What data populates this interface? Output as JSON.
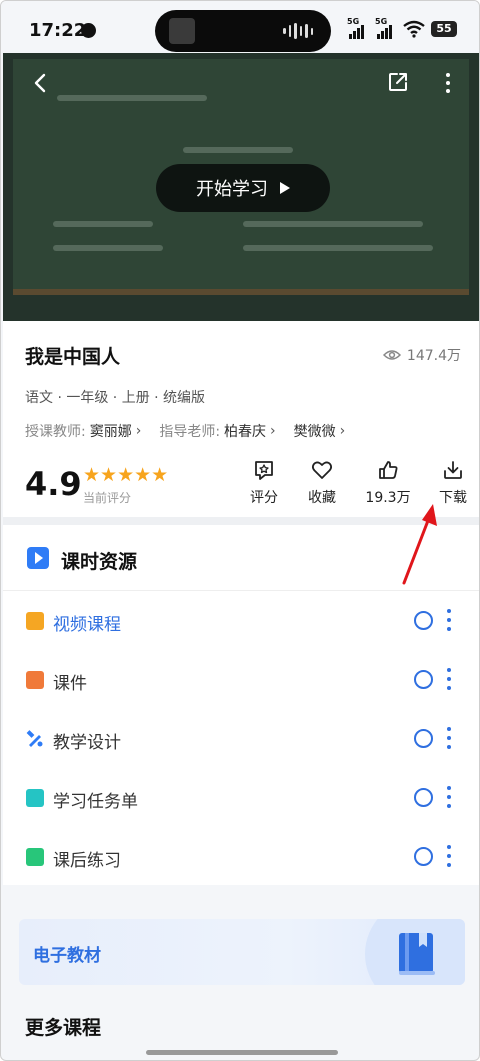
{
  "status_bar": {
    "time": "17:22",
    "signal_1_label": "5G",
    "signal_2_label": "5G",
    "battery": "55"
  },
  "video": {
    "play_label": "开始学习"
  },
  "lesson": {
    "title": "我是中国人",
    "views": "147.4万",
    "meta": "语文 · 一年级 · 上册 · 统编版",
    "teacher_label": "授课教师:",
    "teacher_name": "窦丽娜",
    "advisor_label": "指导老师:",
    "advisor_1": "柏春庆",
    "advisor_2": "樊微微",
    "rating": "4.9",
    "stars": "★★★★★",
    "rating_caption": "当前评分"
  },
  "actions": {
    "rate": "评分",
    "favorite": "收藏",
    "like_count": "19.3万",
    "download": "下载"
  },
  "resources": {
    "title": "课时资源",
    "items": [
      {
        "label": "视频课程",
        "icon": "video-course-icon",
        "color": "#f5a623"
      },
      {
        "label": "课件",
        "icon": "courseware-icon",
        "color": "#f07a3a"
      },
      {
        "label": "教学设计",
        "icon": "teaching-design-icon",
        "color": "#2f7cf6"
      },
      {
        "label": "学习任务单",
        "icon": "task-sheet-icon",
        "color": "#25c4c4"
      },
      {
        "label": "课后练习",
        "icon": "exercise-icon",
        "color": "#28c67a"
      }
    ]
  },
  "ebook": {
    "label": "电子教材"
  },
  "more_courses": {
    "title": "更多课程"
  },
  "colors": {
    "accent": "#2f6fe0",
    "star": "#f7a41d",
    "annotation": "#e0161b"
  }
}
